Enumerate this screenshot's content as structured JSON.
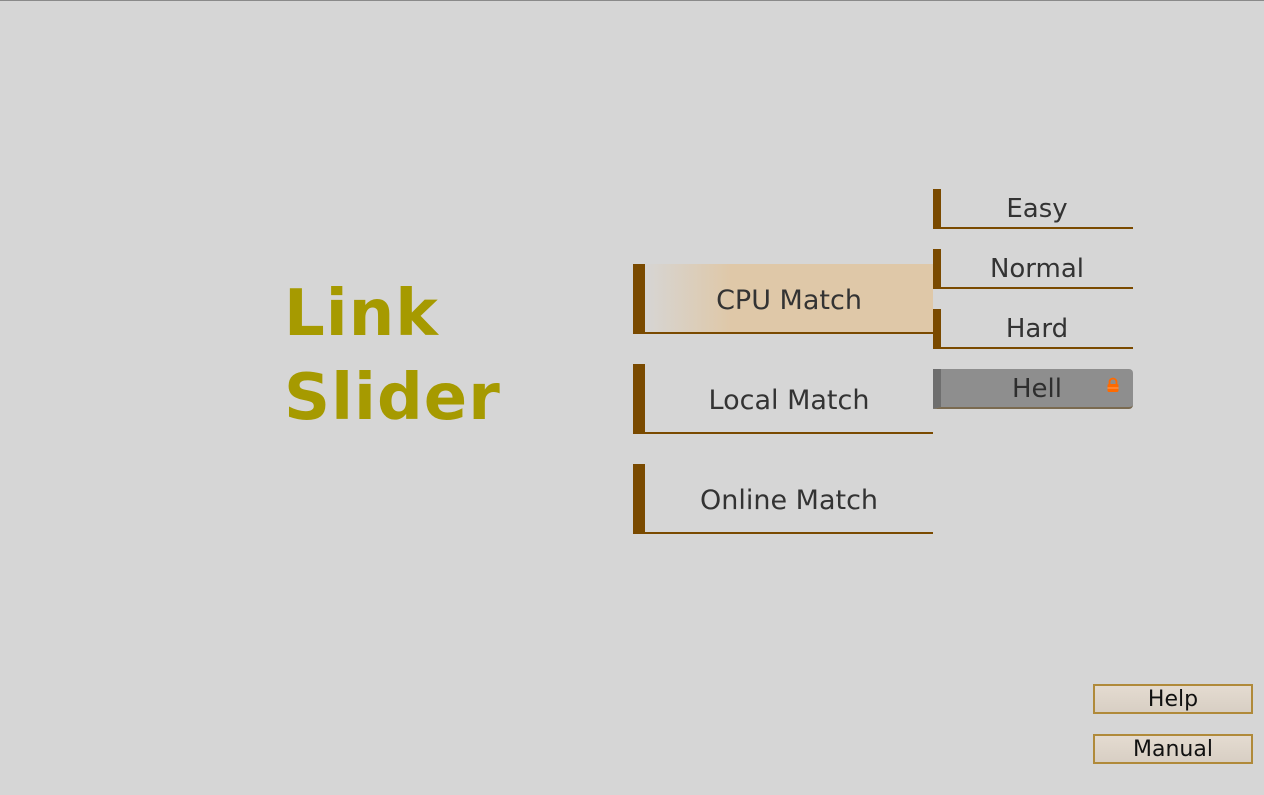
{
  "title": {
    "line1": "Link",
    "line2": "Slider"
  },
  "menu": {
    "cpu_match": "CPU Match",
    "local_match": "Local Match",
    "online_match": "Online Match"
  },
  "difficulty": {
    "easy": "Easy",
    "normal": "Normal",
    "hard": "Hard",
    "hell": "Hell",
    "hell_locked": true,
    "lock_icon": "lock-icon"
  },
  "footer": {
    "help": "Help",
    "manual": "Manual"
  },
  "colors": {
    "logo": "#a69a00",
    "accent": "#7a4a00",
    "active_bg": "#dfc8a8",
    "lock": "#ff6a00"
  }
}
